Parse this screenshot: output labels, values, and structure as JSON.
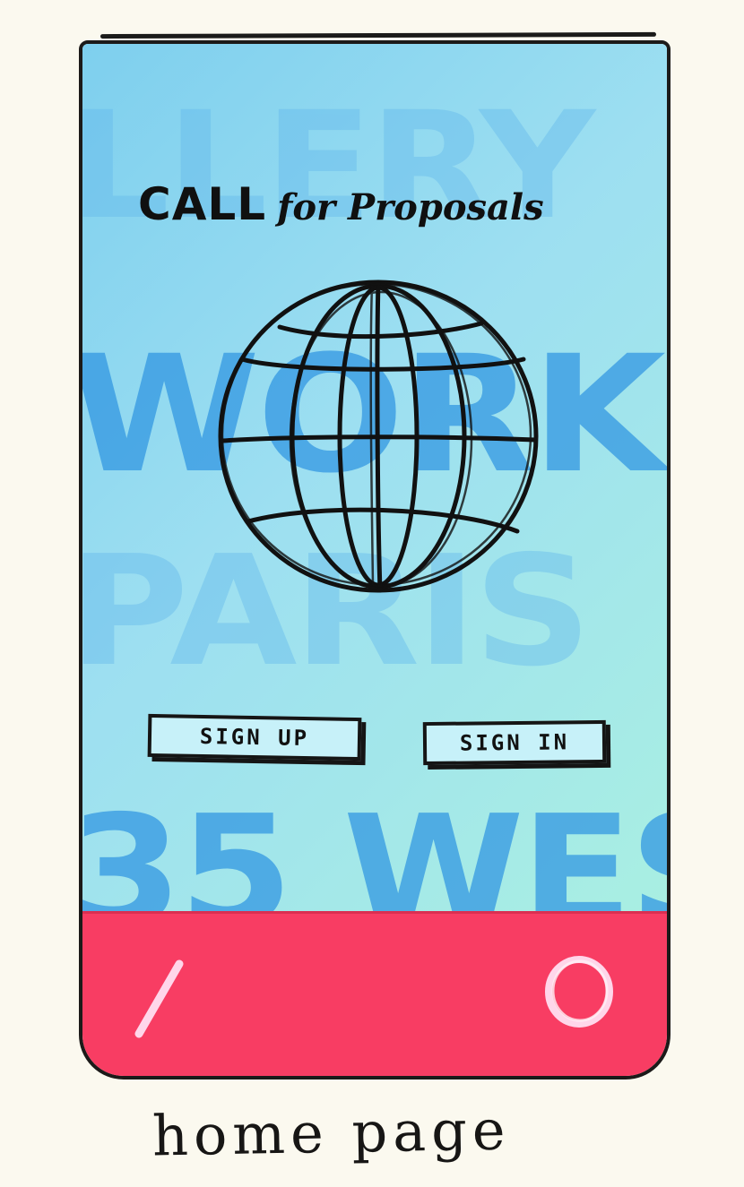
{
  "screen": {
    "title_main": "CALL",
    "title_rest": "for Proposals",
    "background_words": [
      "LLERY",
      "WORKSH",
      "PARIS",
      "35 WES"
    ],
    "buttons": {
      "sign_up": "SIGN UP",
      "sign_in": "SIGN IN"
    }
  },
  "bottom_nav": {
    "back_icon": "slash-back-icon",
    "home_icon": "circle-home-icon",
    "background_color": "#f83d63",
    "icon_color": "#ffd6ea"
  },
  "caption": "home page",
  "colors": {
    "screen_blue": "#7ecfee",
    "ink": "#151515",
    "paper": "#fbf9ef"
  }
}
